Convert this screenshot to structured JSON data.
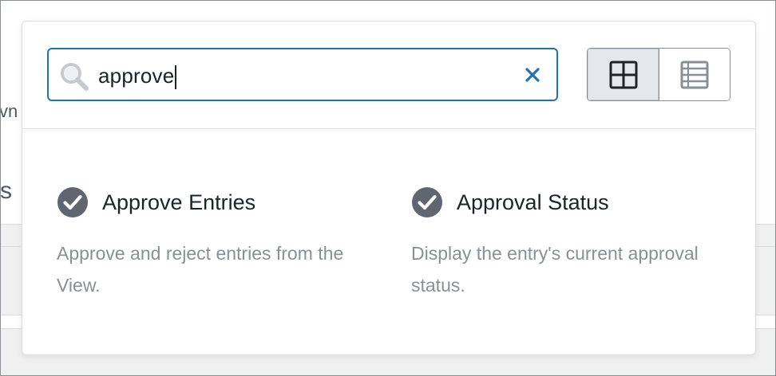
{
  "background": {
    "partial_text_1": "vn",
    "partial_text_2": "s"
  },
  "search": {
    "value": "approve",
    "icon": "search-icon",
    "clear_icon": "close-icon"
  },
  "view_toggle": {
    "grid_icon": "grid-view-icon",
    "list_icon": "list-view-icon",
    "active": "grid"
  },
  "results": [
    {
      "title": "Approve Entries",
      "description": "Approve and reject entries from the View.",
      "icon": "checkmark-circle-icon"
    },
    {
      "title": "Approval Status",
      "description": "Display the entry's current approval status.",
      "icon": "checkmark-circle-icon"
    }
  ],
  "colors": {
    "accent": "#2271b1",
    "icon_gray": "#5f6670",
    "text": "#1d2327",
    "muted": "#8a8f95"
  }
}
